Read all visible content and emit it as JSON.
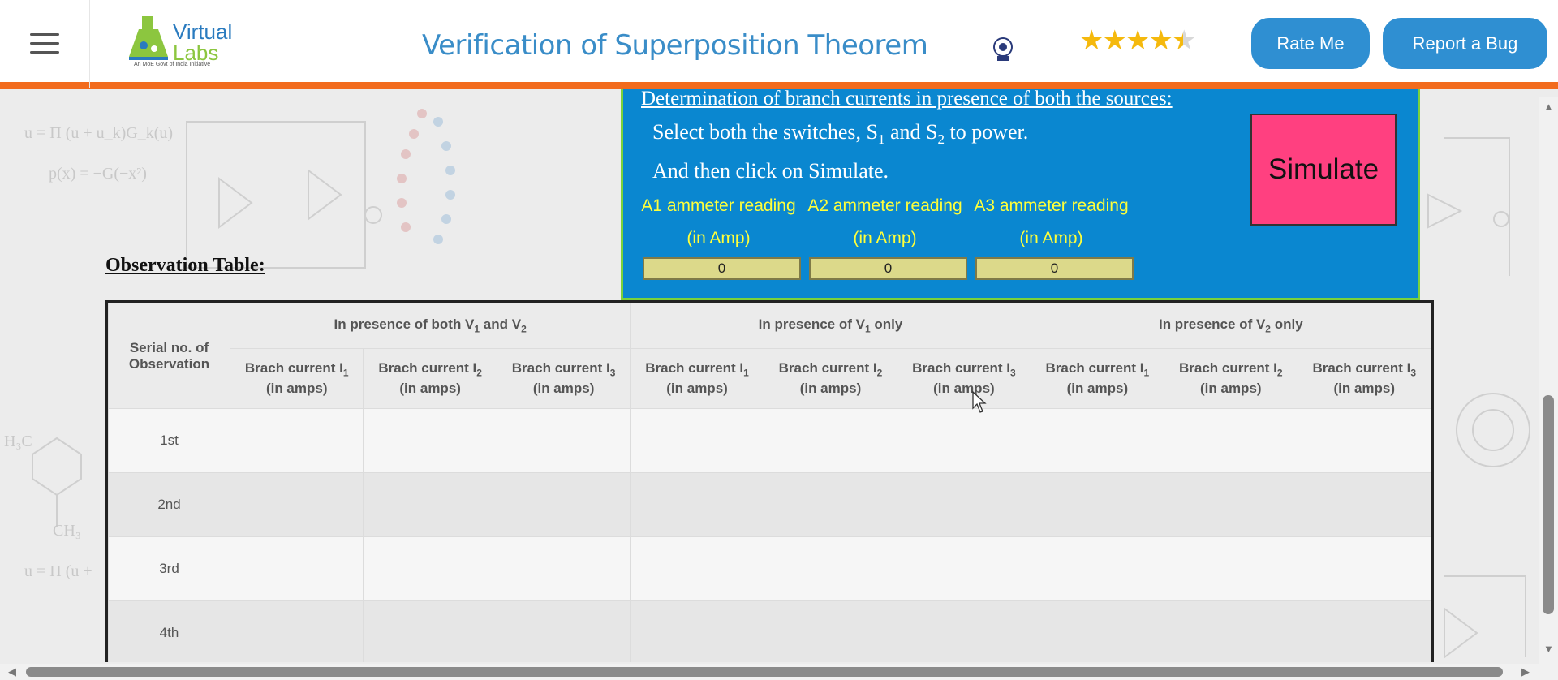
{
  "header": {
    "logo": {
      "line1": "Virtual",
      "line2": "Labs",
      "tagline": "An MoE Govt of India Initiative"
    },
    "title": "Verification of Superposition Theorem",
    "rating_stars": 4.5,
    "rate_button": "Rate Me",
    "bug_button": "Report a Bug"
  },
  "sim": {
    "heading": "Determination of branch currents in presence of both the sources:",
    "instruction_prefix": "Select both the switches, S",
    "instruction_and": " and S",
    "instruction_suffix": " to power.",
    "sub1": "1",
    "sub2": "2",
    "instruction2": "And then click on Simulate.",
    "meters": [
      {
        "label": "A1 ammeter reading",
        "unit": "(in Amp)",
        "value": "0"
      },
      {
        "label": "A2 ammeter reading",
        "unit": "(in Amp)",
        "value": "0"
      },
      {
        "label": "A3 ammeter reading",
        "unit": "(in Amp)",
        "value": "0"
      }
    ],
    "simulate_button": "Simulate"
  },
  "observation": {
    "title": "Observation Table:",
    "serial_header": "Serial no. of Observation",
    "groups": [
      {
        "prefix": "In presence of both V",
        "s1": "1",
        "mid": " and V",
        "s2": "2",
        "suffix": ""
      },
      {
        "prefix": "In presence of V",
        "s1": "1",
        "mid": " only",
        "s2": "",
        "suffix": ""
      },
      {
        "prefix": "In presence of V",
        "s1": "2",
        "mid": " only",
        "s2": "",
        "suffix": ""
      }
    ],
    "col_prefix": "Brach current I",
    "col_unit": "(in amps)",
    "rows": [
      "1st",
      "2nd",
      "3rd",
      "4th"
    ]
  },
  "colors": {
    "accent_orange": "#f26b1d",
    "title_blue": "#3a8dc8",
    "button_blue": "#2f8fd2",
    "panel_blue": "#0a87d0",
    "meter_text": "#ffff3a",
    "simulate_pink": "#ff4080"
  }
}
